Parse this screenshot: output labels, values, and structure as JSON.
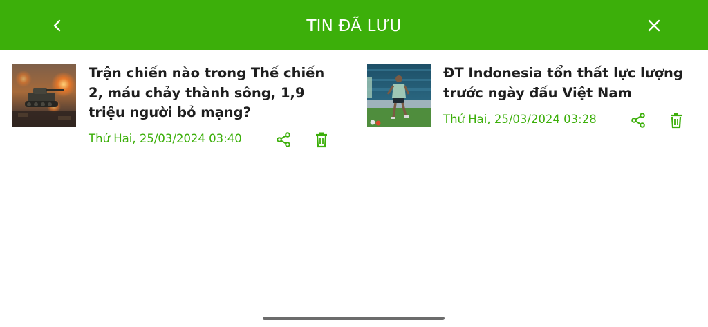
{
  "header": {
    "title": "TIN ĐÃ LƯU",
    "back_icon": "chevron-left-icon",
    "close_icon": "close-icon",
    "background": "#3caf0a"
  },
  "saved_items": [
    {
      "headline": "Trận chiến nào trong Thế chiến 2, máu chảy thành sông, 1,9 triệu người bỏ mạng?",
      "date": "Thứ Hai, 25/03/2024 03:40",
      "thumbnail": "war-tank-photo",
      "share_icon": "share-icon",
      "delete_icon": "trash-icon"
    },
    {
      "headline": "ĐT Indonesia tổn thất lực lượng trước ngày đấu Việt Nam",
      "date": "Thứ Hai, 25/03/2024 03:28",
      "thumbnail": "football-player-photo",
      "share_icon": "share-icon",
      "delete_icon": "trash-icon"
    }
  ],
  "colors": {
    "accent": "#3caf0a",
    "headline_text": "#1e1e1e"
  }
}
